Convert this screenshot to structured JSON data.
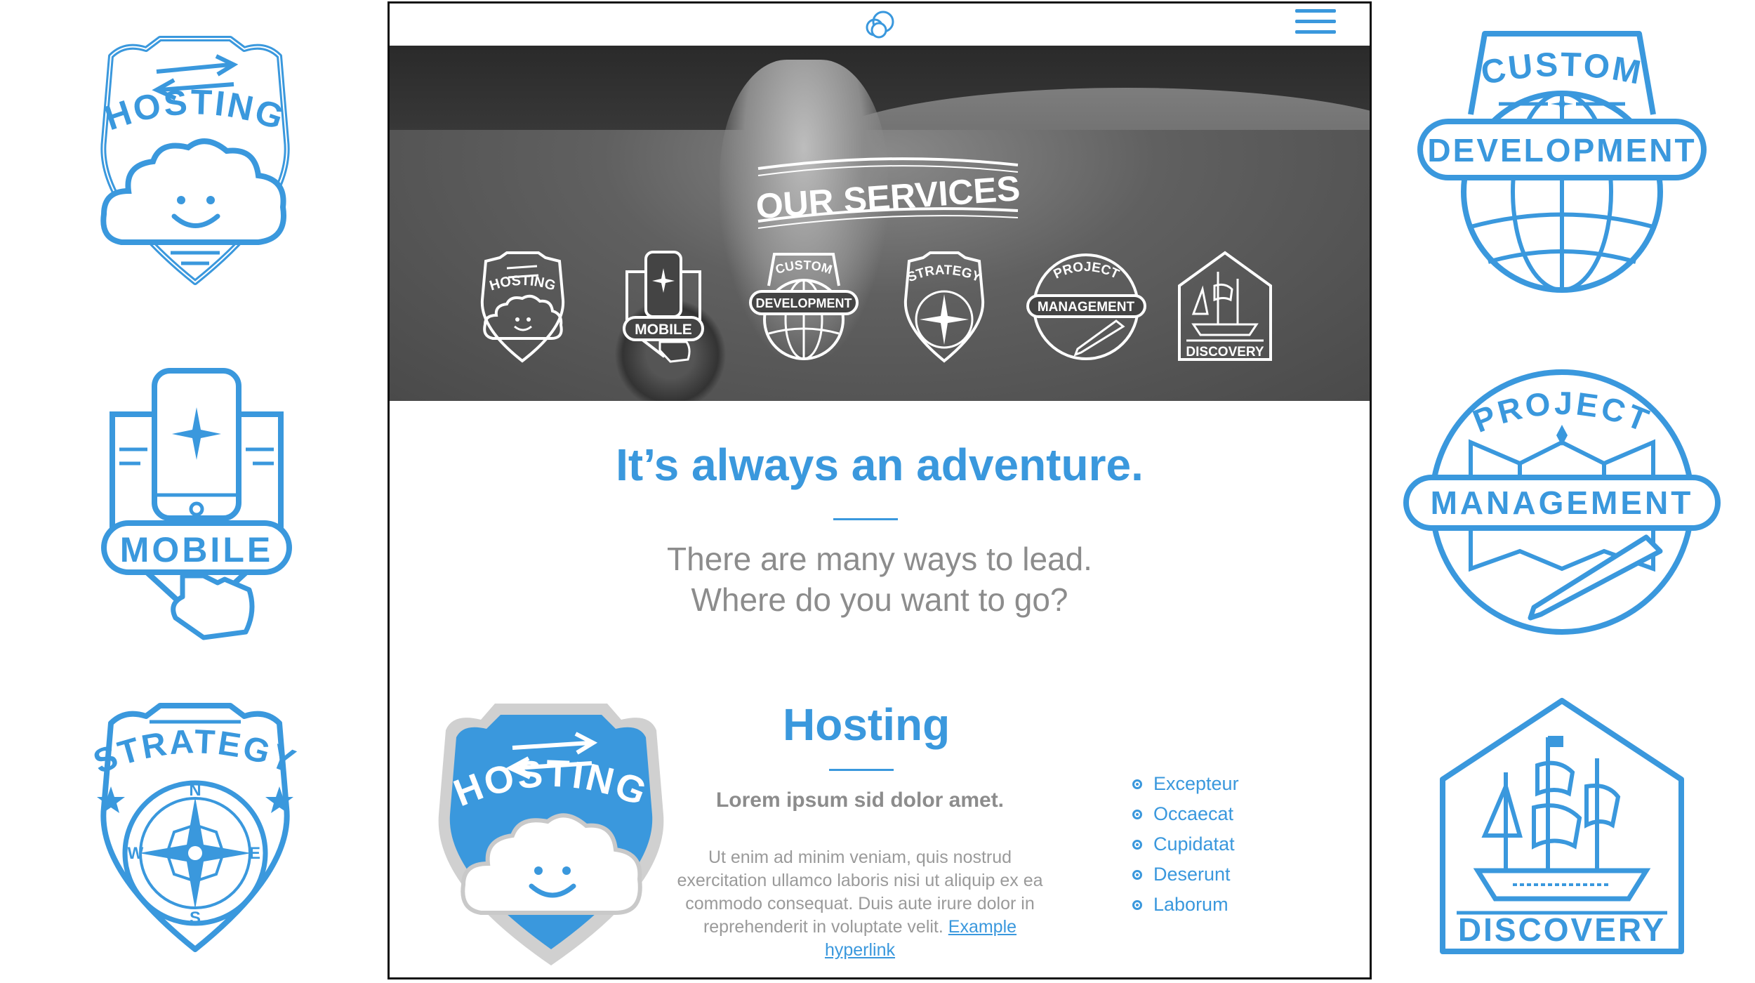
{
  "colors": {
    "accent": "#3a98dd",
    "muted": "#8c8c8c",
    "frame": "#111111"
  },
  "side_badges": [
    {
      "name": "hosting",
      "text": "HOSTING"
    },
    {
      "name": "mobile",
      "text": "MOBILE"
    },
    {
      "name": "strategy",
      "text": "STRATEGY"
    },
    {
      "name": "custom-development",
      "top": "CUSTOM",
      "text": "DEVELOPMENT"
    },
    {
      "name": "project-management",
      "top": "PROJECT",
      "text": "MANAGEMENT"
    },
    {
      "name": "discovery",
      "text": "DISCOVERY"
    }
  ],
  "compass": {
    "n": "N",
    "e": "E",
    "s": "S",
    "w": "W"
  },
  "header": {
    "logo_icon": "cloud-logo-icon",
    "menu_icon": "hamburger-menu-icon"
  },
  "hero": {
    "title": "OUR SERVICES",
    "icons": [
      {
        "label": "HOSTING"
      },
      {
        "label": "MOBILE"
      },
      {
        "top": "CUSTOM",
        "label": "DEVELOPMENT"
      },
      {
        "label": "STRATEGY"
      },
      {
        "top": "PROJECT",
        "label": "MANAGEMENT"
      },
      {
        "label": "DISCOVERY"
      }
    ]
  },
  "intro": {
    "title": "It’s always an adventure.",
    "line1": "There are many ways to lead.",
    "line2": "Where do you want to go?"
  },
  "hosting_section": {
    "badge_text": "HOSTING",
    "title": "Hosting",
    "subhead": "Lorem ipsum sid dolor amet.",
    "body_line1": "Ut enim ad minim veniam, quis nostrud",
    "body_line2": "exercitation ullamco laboris nisi ut aliquip ex ea",
    "body_line3": "commodo consequat. Duis aute irure dolor in",
    "body_line4": "reprehenderit in voluptate velit.",
    "link": "Example hyperlink",
    "bullets": [
      "Excepteur",
      "Occaecat",
      "Cupidatat",
      "Deserunt",
      "Laborum"
    ]
  }
}
